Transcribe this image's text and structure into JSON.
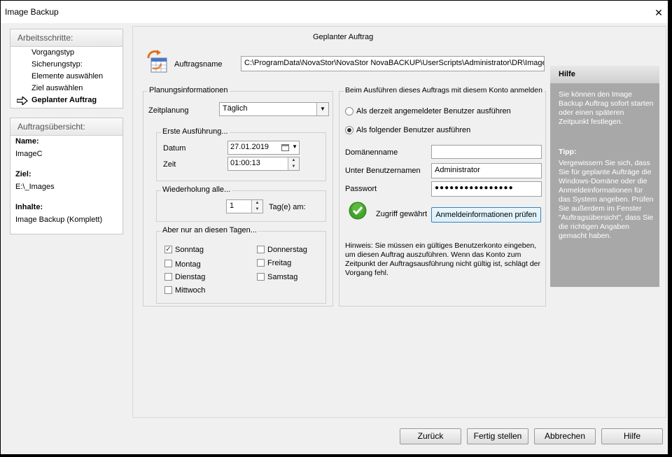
{
  "window": {
    "title": "Image Backup",
    "close_glyph": "✕"
  },
  "steps": {
    "heading": "Arbeitsschritte:",
    "items": [
      "Vorgangstyp",
      "Sicherungstyp:",
      "Elemente auswählen",
      "Ziel auswählen",
      "Geplanter Auftrag"
    ],
    "active_index": 4
  },
  "summary": {
    "heading": "Auftragsübersicht:",
    "name_label": "Name:",
    "name_value": "ImageC",
    "target_label": "Ziel:",
    "target_value": "E:\\_Images",
    "content_label": "Inhalte:",
    "content_value": "Image Backup (Komplett)"
  },
  "main": {
    "title": "Geplanter Auftrag",
    "job_name_label": "Auftragsname",
    "job_name_value": "C:\\ProgramData\\NovaStor\\NovaStor NovaBACKUP\\UserScripts\\Administrator\\DR\\ImageC",
    "job_icon": "schedule-calendar-icon"
  },
  "planning": {
    "group_title": "Planungsinformationen",
    "schedule_label": "Zeitplanung",
    "schedule_value": "Täglich",
    "first_run_title": "Erste Ausführung...",
    "date_label": "Datum",
    "date_value": "27.01.2019",
    "time_label": "Zeit",
    "time_value": "01:00:13",
    "repeat_title": "Wiederholung alle...",
    "repeat_value": "1",
    "repeat_unit": "Tag(e) am:",
    "days_title": "Aber nur an diesen Tagen...",
    "days": [
      {
        "label": "Sonntag",
        "checked": true
      },
      {
        "label": "Montag",
        "checked": false
      },
      {
        "label": "Dienstag",
        "checked": false
      },
      {
        "label": "Mittwoch",
        "checked": false
      },
      {
        "label": "Donnerstag",
        "checked": false
      },
      {
        "label": "Freitag",
        "checked": false
      },
      {
        "label": "Samstag",
        "checked": false
      }
    ]
  },
  "account": {
    "group_title": "Beim Ausführen dieses Auftrags mit diesem Konto anmelden",
    "radio_current": "Als derzeit angemeldeter Benutzer ausführen",
    "radio_other": "Als folgender Benutzer ausführen",
    "selected": "other",
    "domain_label": "Domänenname",
    "domain_value": "",
    "user_label": "Unter Benutzernamen",
    "user_value": "Administrator",
    "password_label": "Passwort",
    "password_value": "●●●●●●●●●●●●●●●●",
    "access_status": "Zugriff gewährt",
    "check_button": "Anmeldeinformationen prüfen",
    "note": "Hinweis: Sie müssen ein gültiges Benutzerkonto eingeben, um diesen Auftrag auszuführen. Wenn das Konto zum Zeitpunkt der Auftragsausführung nicht gültig ist, schlägt der Vorgang fehl."
  },
  "help": {
    "title": "Hilfe",
    "text1": "Sie können den Image Backup Auftrag sofort starten oder einen späteren Zeitpunkt festlegen.",
    "tip_label": "Tipp:",
    "text2": "Vergewissern Sie sich, dass Sie für geplante Aufträge die Windows-Domäne oder die Anmeldeinformationen für das System angeben. Prüfen Sie außerdem im Fenster \"Auftragsübersicht\", dass Sie die richtigen Angaben gemacht haben."
  },
  "buttons": {
    "back": "Zurück",
    "finish": "Fertig stellen",
    "cancel": "Abbrechen",
    "help": "Hilfe"
  },
  "colors": {
    "check_ok": "#43a32a",
    "help_bg": "#a8a8a8",
    "arrow": "#0050a0"
  }
}
